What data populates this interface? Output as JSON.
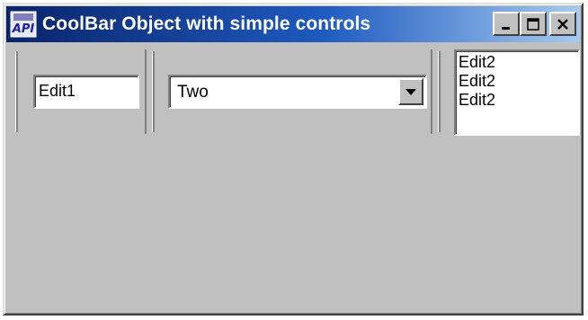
{
  "window": {
    "title": "CoolBar Object with simple controls",
    "icon": "api-app-icon",
    "icon_text": "API",
    "buttons": [
      "minimize",
      "maximize",
      "close"
    ]
  },
  "coolbar": {
    "edit1": {
      "value": "Edit1"
    },
    "combo": {
      "selected": "Two"
    },
    "edit2": {
      "lines": [
        "Edit2",
        "Edit2",
        "Edit2"
      ]
    }
  },
  "colors": {
    "face": "#c0c0c0",
    "title_start": "#0a246a",
    "title_end": "#a6caf0"
  }
}
